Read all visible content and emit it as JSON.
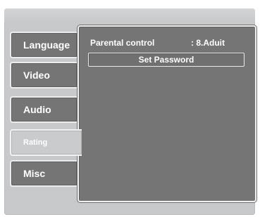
{
  "tabs": [
    {
      "label": "Language",
      "active": false
    },
    {
      "label": "Video",
      "active": false
    },
    {
      "label": "Audio",
      "active": false
    },
    {
      "label": "Rating",
      "active": true
    },
    {
      "label": "Misc",
      "active": false
    }
  ],
  "rating_panel": {
    "parental_control_label": "Parental control",
    "parental_control_value": ": 8.Aduit",
    "set_password_label": "Set Password"
  },
  "colors": {
    "panel": "#757575",
    "active_tab": "#c9cbcd",
    "frame": "#c7c9cb"
  }
}
